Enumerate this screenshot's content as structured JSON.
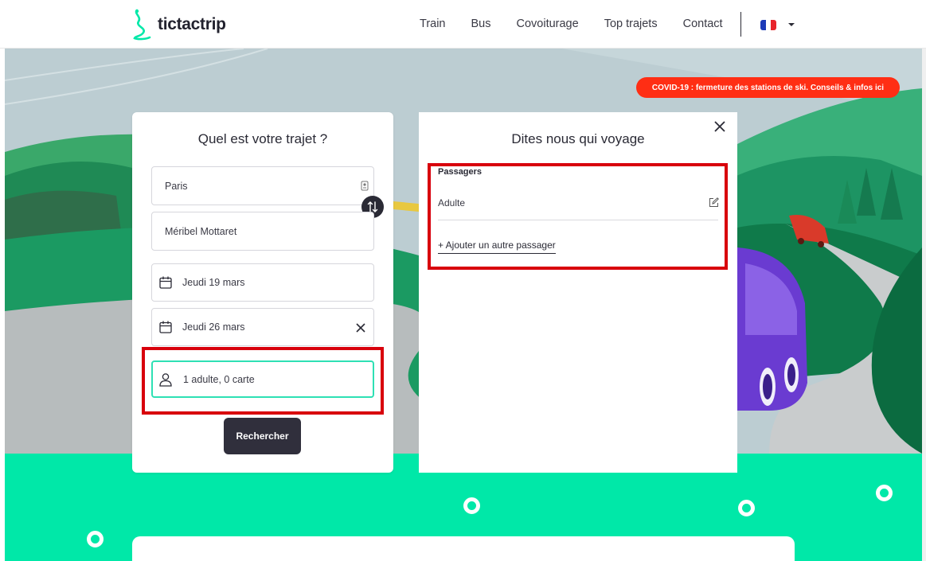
{
  "header": {
    "brand": "tictactrip",
    "nav": [
      "Train",
      "Bus",
      "Covoiturage",
      "Top trajets",
      "Contact"
    ],
    "language": "French flag"
  },
  "banner": {
    "text": "COVID-19 : fermeture des stations de ski. Conseils & infos ici"
  },
  "search": {
    "title": "Quel est votre trajet ?",
    "from": "Paris",
    "to": "Méribel Mottaret",
    "depart_date": "Jeudi 19 mars",
    "return_date": "Jeudi 26 mars",
    "passengers": "1 adulte, 0 carte",
    "submit": "Rechercher"
  },
  "passengers_panel": {
    "title": "Dites nous qui voyage",
    "section_label": "Passagers",
    "passenger": "Adulte",
    "add_label": "+ Ajouter un autre passager"
  },
  "colors": {
    "accent": "#00e8a8",
    "banner": "#ff2e14",
    "highlight": "#d8000c",
    "button": "#302f3c",
    "field_focus": "#2ee0b4"
  }
}
